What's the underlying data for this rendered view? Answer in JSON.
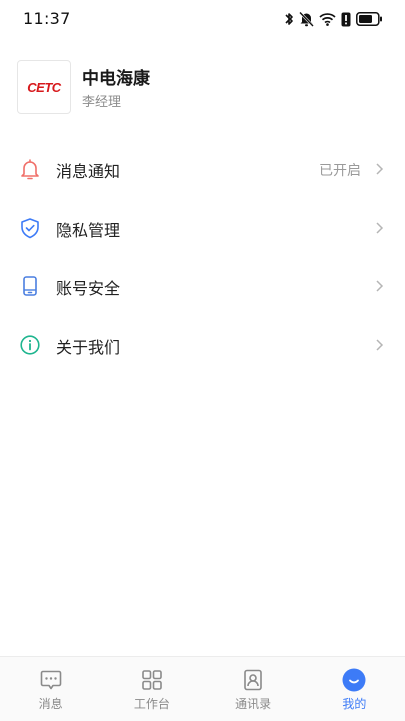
{
  "status_bar": {
    "time": "11:37",
    "icons": [
      "bluetooth-icon",
      "mute-icon",
      "wifi-icon",
      "alert-icon",
      "battery-icon"
    ]
  },
  "profile": {
    "logo_text": "CETC",
    "company": "中电海康",
    "role": "李经理"
  },
  "menu": {
    "items": [
      {
        "label": "消息通知",
        "value": "已开启",
        "icon": "bell-icon"
      },
      {
        "label": "隐私管理",
        "value": "",
        "icon": "shield-check-icon"
      },
      {
        "label": "账号安全",
        "value": "",
        "icon": "phone-icon"
      },
      {
        "label": "关于我们",
        "value": "",
        "icon": "info-icon"
      }
    ]
  },
  "tabbar": {
    "tabs": [
      {
        "label": "消息",
        "icon": "chat-icon",
        "active": false
      },
      {
        "label": "工作台",
        "icon": "grid-icon",
        "active": false
      },
      {
        "label": "通讯录",
        "icon": "contacts-icon",
        "active": false
      },
      {
        "label": "我的",
        "icon": "smile-icon",
        "active": true
      }
    ]
  },
  "colors": {
    "accent": "#3d7bf7",
    "bell": "#f0706a",
    "shield": "#3d7bf7",
    "phone": "#4a7fe0",
    "info": "#1fb58f",
    "logo": "#d7191c"
  }
}
